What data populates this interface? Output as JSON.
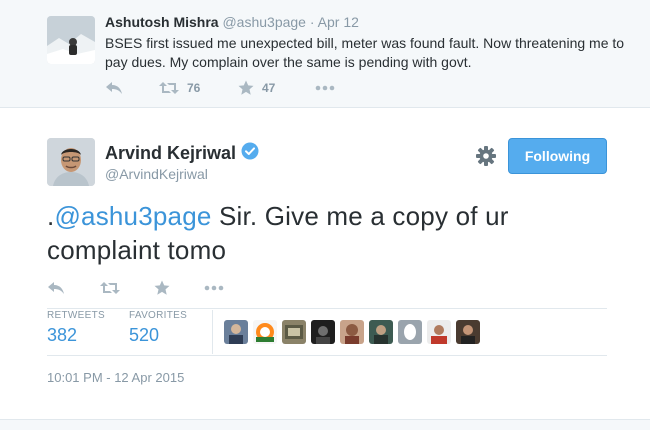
{
  "parent_tweet": {
    "name": "Ashutosh Mishra",
    "handle": "@ashu3page",
    "separator": " · ",
    "date": "Apr 12",
    "text": "BSES first issued me unexpected bill, meter was found fault. Now threatening me to pay dues. My complain over the same is pending with govt.",
    "retweets": "76",
    "favorites": "47",
    "icons": [
      "reply-icon",
      "retweet-icon",
      "favorite-icon",
      "more-icon"
    ]
  },
  "main_tweet": {
    "name": "Arvind Kejriwal",
    "handle": "@ArvindKejriwal",
    "follow_label": "Following",
    "text_prefix": ".",
    "mention": "@ashu3page",
    "text_rest": " Sir. Give me a copy of ur complaint tomo",
    "stats": {
      "retweets_label": "RETWEETS",
      "retweets_value": "382",
      "favorites_label": "FAVORITES",
      "favorites_value": "520"
    },
    "timestamp": "10:01 PM - 12 Apr 2015",
    "icons": [
      "verified-badge-icon",
      "gear-icon",
      "reply-icon",
      "retweet-icon",
      "favorite-icon",
      "more-icon"
    ]
  },
  "colors": {
    "accent": "#55acee",
    "link": "#3b94d9",
    "muted": "#8899a6",
    "text": "#292f33",
    "parent_bg": "#f5f8fa"
  },
  "favoriters_count_shown": 9
}
